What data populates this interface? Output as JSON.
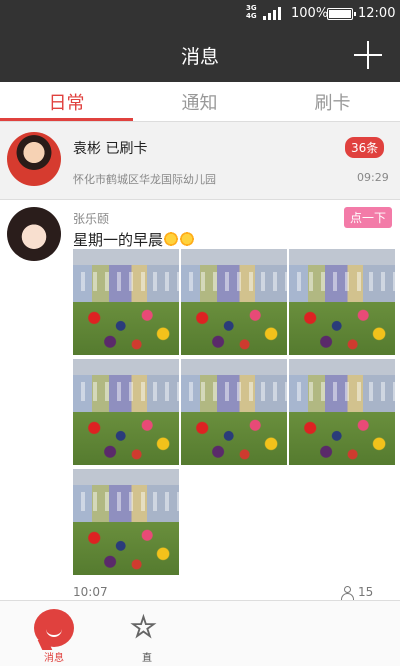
{
  "status_bar": {
    "network": "3G\n4G",
    "battery": "100%",
    "time": "12:00"
  },
  "header": {
    "title": "消息"
  },
  "tabs": [
    {
      "label": "日常",
      "active": true
    },
    {
      "label": "通知",
      "active": false
    },
    {
      "label": "刷卡",
      "active": false
    }
  ],
  "card_notice": {
    "name": "袁彬  已刷卡",
    "school": "怀化市鹤城区华龙国际幼儿园",
    "badge": "36条",
    "time": "09:29"
  },
  "post": {
    "author": "张乐颐",
    "button": "点一下",
    "text": "星期一的早晨",
    "photo_count": 7,
    "time": "10:07",
    "viewer_count": "15"
  },
  "bottom_nav": [
    {
      "label": "消息",
      "icon": "chat-bubble-icon",
      "active": true
    },
    {
      "label": "直",
      "icon": "star-icon",
      "active": false
    }
  ],
  "colors": {
    "accent": "#e0413e",
    "header_bg": "#333333",
    "pink_button": "#f37ba8"
  }
}
